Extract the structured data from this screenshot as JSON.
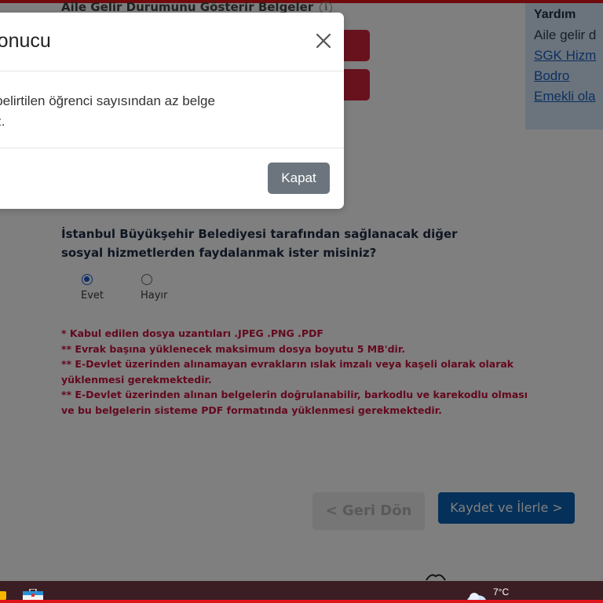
{
  "background_page": {
    "doc_heading": "Aile Gelir Durumunu Gösterir Belgeler",
    "info_icon": "info-icon",
    "help": {
      "title": "Yardım",
      "line": "Aile gelir d",
      "links": [
        "SGK Hizm",
        "Bodro",
        "Emekli ola"
      ]
    },
    "question": "İstanbul Büyükşehir Belediyesi tarafından sağlanacak diğer sosyal hizmetlerden faydalanmak ister misiniz?",
    "options": [
      {
        "label": "Evet",
        "checked": true
      },
      {
        "label": "Hayır",
        "checked": false
      }
    ],
    "notes": [
      "* Kabul edilen dosya uzantıları .JPEG .PNG .PDF",
      "** Evrak başına yüklenecek maksimum dosya boyutu 5 MB'dir.",
      "** E-Devlet üzerinden alınamayan evrakların ıslak imzalı veya kaşeli olarak olarak yüklenmesi gerekmektedir.",
      "** E-Devlet üzerinden alınan belgelerin doğrulanabilir, barkodlu ve karekodlu olması ve bu belgelerin sisteme PDF formatında yüklenmesi gerekmektedir."
    ],
    "back_button": "< Geri Dön",
    "next_button": "Kaydet ve İlerle >"
  },
  "modal": {
    "title": "Sonucu",
    "body": "e belirtilen öğrenci sayısından az belge niz.",
    "body_line1": "e belirtilen öğrenci sayısından az belge",
    "body_line2": "niz.",
    "close_button": "Kapat",
    "close_icon": "close-icon"
  },
  "taskbar": {
    "temperature": "7°C",
    "icons": [
      "folder-icon",
      "briefcase-icon",
      "weather-icon"
    ]
  },
  "colors": {
    "accent_red": "#e0151b",
    "note_red": "#c8123f",
    "primary_blue": "#0b61b2",
    "help_bg": "#d6e9fb",
    "modal_button": "#6c757d"
  }
}
